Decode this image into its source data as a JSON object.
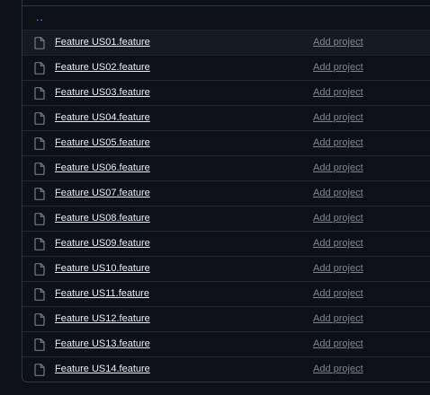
{
  "table": {
    "parent_link": "..",
    "files": [
      {
        "name": "Feature US01.feature",
        "commit": "Add project"
      },
      {
        "name": "Feature US02.feature",
        "commit": "Add project"
      },
      {
        "name": "Feature US03.feature",
        "commit": "Add project"
      },
      {
        "name": "Feature US04.feature",
        "commit": "Add project"
      },
      {
        "name": "Feature US05.feature",
        "commit": "Add project"
      },
      {
        "name": "Feature US06.feature",
        "commit": "Add project"
      },
      {
        "name": "Feature US07.feature",
        "commit": "Add project"
      },
      {
        "name": "Feature US08.feature",
        "commit": "Add project"
      },
      {
        "name": "Feature US09.feature",
        "commit": "Add project"
      },
      {
        "name": "Feature US10.feature",
        "commit": "Add project"
      },
      {
        "name": "Feature US11.feature",
        "commit": "Add project"
      },
      {
        "name": "Feature US12.feature",
        "commit": "Add project"
      },
      {
        "name": "Feature US13.feature",
        "commit": "Add project"
      },
      {
        "name": "Feature US14.feature",
        "commit": "Add project"
      }
    ]
  },
  "colors": {
    "background": "#0d1117",
    "border": "#30363d",
    "row_divider": "#21262d",
    "hover_row": "#161b22",
    "link": "#58a6ff",
    "file_text": "#e6edf3",
    "muted_text": "#7d8590",
    "icon": "#7d8590"
  },
  "icons": {
    "file": "file-icon"
  }
}
